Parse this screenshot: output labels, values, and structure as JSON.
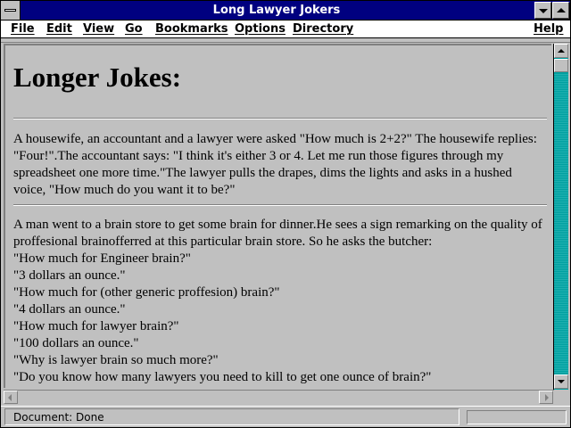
{
  "window": {
    "title": "Long Lawyer Jokers"
  },
  "menu": {
    "file": "File",
    "edit": "Edit",
    "view": "View",
    "go": "Go",
    "bookmarks": "Bookmarks",
    "options": "Options",
    "directory": "Directory",
    "help": "Help"
  },
  "page": {
    "heading": "Longer Jokes:",
    "joke1_lines": [
      "A housewife, an accountant and a lawyer were asked \"How much is 2+2?\" The housewife replies:",
      "\"Four!\".The accountant says: \"I think it's either 3 or 4. Let me run those figures through my",
      "spreadsheet one more time.\"The lawyer pulls the drapes, dims the lights and asks in a hushed",
      "voice, \"How much do you want it to be?\""
    ],
    "joke2_lines": [
      "A man went to a brain store to get some brain for dinner.He sees a sign remarking on the quality of",
      "proffesional brainofferred at this particular brain store. So he asks the butcher:",
      "\"How much for Engineer brain?\"",
      "\"3 dollars an ounce.\"",
      "\"How much for (other generic proffesion) brain?\"",
      "\"4 dollars an ounce.\"",
      "\"How much for lawyer brain?\"",
      "\"100 dollars an ounce.\"",
      "\"Why is lawyer brain so much more?\"",
      "\"Do you know how many lawyers you need to kill to get one ounce of brain?\""
    ]
  },
  "status": {
    "text": "Document: Done"
  },
  "colors": {
    "titlebar": "#000080",
    "scrollbar_track": "#00a0a0",
    "chrome": "#c0c0c0"
  }
}
